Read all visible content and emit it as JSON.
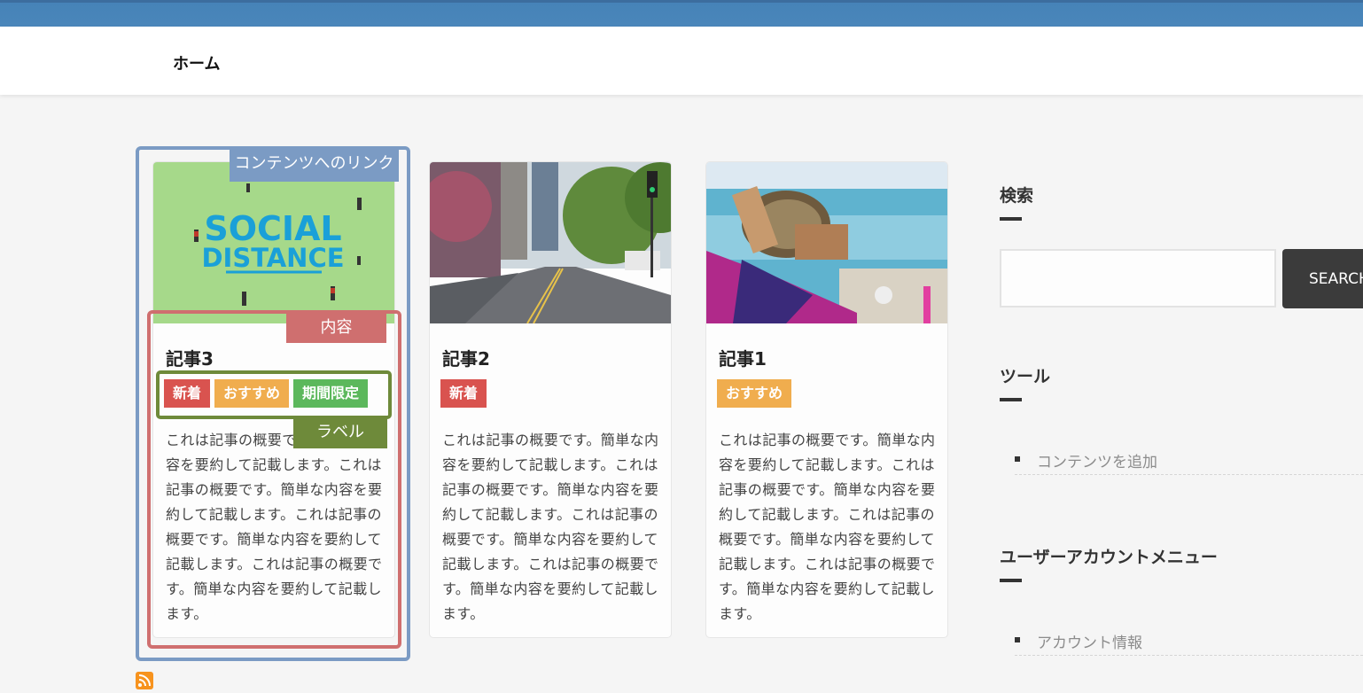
{
  "nav": {
    "home": "ホーム"
  },
  "annotations": {
    "link": "コンテンツへのリンク",
    "content": "内容",
    "label": "ラベル"
  },
  "cards": [
    {
      "title": "記事3",
      "image": "social-distance-image",
      "image_text": [
        "SOCIAL",
        "DISTANCE"
      ],
      "labels": [
        "新着",
        "おすすめ",
        "期間限定"
      ],
      "summary": "これは記事の概要です。簡単な内容を要約して記載します。これは記事の概要です。簡単な内容を要約して記載します。これは記事の概要です。簡単な内容を要約して記載します。これは記事の概要です。簡単な内容を要約して記載します。"
    },
    {
      "title": "記事2",
      "image": "city-street-image",
      "labels": [
        "新着"
      ],
      "summary": "これは記事の概要です。簡単な内容を要約して記載します。これは記事の概要です。簡単な内容を要約して記載します。これは記事の概要です。簡単な内容を要約して記載します。これは記事の概要です。簡単な内容を要約して記載します。"
    },
    {
      "title": "記事1",
      "image": "beach-image",
      "labels": [
        "おすすめ"
      ],
      "summary": "これは記事の概要です。簡単な内容を要約して記載します。これは記事の概要です。簡単な内容を要約して記載します。これは記事の概要です。簡単な内容を要約して記載します。これは記事の概要です。簡単な内容を要約して記載します。"
    }
  ],
  "sidebar": {
    "search": {
      "heading": "検索",
      "button": "SEARCH"
    },
    "tools": {
      "heading": "ツール",
      "items": [
        "コンテンツを追加"
      ]
    },
    "account": {
      "heading": "ユーザーアカウントメニュー",
      "items": [
        "アカウント情報"
      ]
    }
  },
  "colors": {
    "label_new": "#d9534f",
    "label_recommended": "#f0ad4e",
    "label_limited": "#5cb85c",
    "annotation_link": "#7b9bc4",
    "annotation_content": "#cf6f6f",
    "annotation_label": "#6e8a3a",
    "header_blue": "#4683b8"
  },
  "icons": {
    "feed": "rss-icon"
  }
}
